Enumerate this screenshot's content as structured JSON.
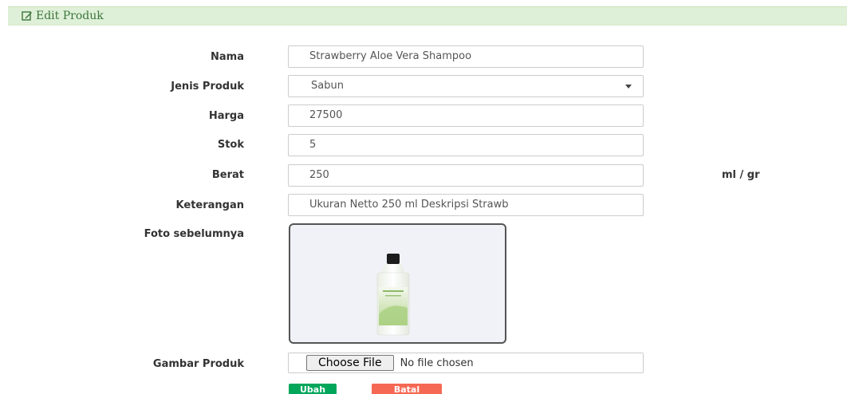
{
  "header": {
    "title": "Edit Produk",
    "icon": "edit-icon",
    "background": "#dff0d8",
    "color": "#3c763d"
  },
  "form": {
    "nama": {
      "label": "Nama",
      "value": "Strawberry Aloe Vera Shampoo"
    },
    "jenis_produk": {
      "label": "Jenis Produk",
      "selected": "Sabun"
    },
    "harga": {
      "label": "Harga",
      "value": "27500"
    },
    "stok": {
      "label": "Stok",
      "value": "5"
    },
    "berat": {
      "label": "Berat",
      "value": "250",
      "unit": "ml / gr"
    },
    "keterangan": {
      "label": "Keterangan",
      "value": "Ukuran Netto 250 ml  Deskripsi Strawb"
    },
    "foto_sebelumnya": {
      "label": "Foto sebelumnya"
    },
    "gambar_produk": {
      "label": "Gambar Produk",
      "button_label": "Choose File",
      "status": "No file chosen"
    }
  },
  "buttons": {
    "ubah": {
      "label": "Ubah",
      "color": "#00a65a"
    },
    "batal": {
      "label": "Batal",
      "color": "#f56954"
    }
  }
}
